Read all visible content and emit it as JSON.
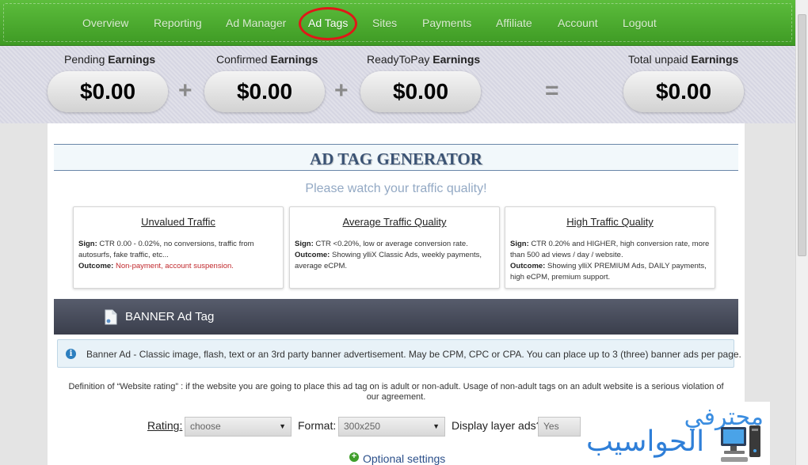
{
  "nav": {
    "items": [
      {
        "label": "Overview"
      },
      {
        "label": "Reporting"
      },
      {
        "label": "Ad Manager"
      },
      {
        "label": "Ad Tags"
      },
      {
        "label": "Sites"
      },
      {
        "label": "Payments"
      },
      {
        "label": "Affiliate"
      },
      {
        "label": "Account"
      },
      {
        "label": "Logout"
      }
    ],
    "active": "Ad Tags"
  },
  "earnings": {
    "pending": {
      "prefix": "Pending",
      "suffix": "Earnings",
      "value": "$0.00"
    },
    "confirmed": {
      "prefix": "Confirmed",
      "suffix": "Earnings",
      "value": "$0.00"
    },
    "readytopay": {
      "prefix": "ReadyToPay",
      "suffix": "Earnings",
      "value": "$0.00"
    },
    "total": {
      "prefix": "Total unpaid",
      "suffix": "Earnings",
      "value": "$0.00"
    },
    "plus": "+",
    "equals": "="
  },
  "generator": {
    "title": "AD TAG GENERATOR",
    "subtitle": "Please watch your traffic quality!"
  },
  "cards": [
    {
      "title": "Unvalued Traffic",
      "sign_label": "Sign:",
      "sign_text": "CTR 0.00 - 0.02%, no conversions, traffic from autosurfs, fake traffic, etc...",
      "outcome_label": "Outcome:",
      "outcome_text": "Non-payment, account suspension."
    },
    {
      "title": "Average Traffic Quality",
      "sign_label": "Sign:",
      "sign_text": "CTR <0.20%, low or average conversion rate.",
      "outcome_label": "Outcome:",
      "outcome_text": "Showing ylliX Classic Ads, weekly payments, average eCPM."
    },
    {
      "title": "High Traffic Quality",
      "sign_label": "Sign:",
      "sign_text": "CTR 0.20% and HIGHER, high conversion rate, more than 500 ad views / day / website.",
      "outcome_label": "Outcome:",
      "outcome_text": "Showing ylliX PREMIUM Ads, DAILY payments, high eCPM, premium support."
    }
  ],
  "banner": {
    "title": "BANNER Ad Tag",
    "info": "Banner Ad - Classic image, flash, text or an 3rd party banner advertisement. May be CPM, CPC or CPA. You can place up to 3 (three) banner ads per page.",
    "definition": "Definition of “Website rating” : if the website you are going to place this ad tag on is adult or non-adult. Usage of non-adult tags on an adult website is a serious violation of our agreement."
  },
  "form": {
    "rating_label": "Rating:",
    "rating_value": "choose",
    "format_label": "Format:",
    "format_value": "300x250",
    "layer_label": "Display layer ads?",
    "layer_value": "Yes",
    "arrow": "▼"
  },
  "optional": {
    "icon": "+",
    "label": "Optional settings"
  },
  "logo": {
    "word1": "محترفي",
    "word2": "الحواسيب"
  },
  "colors": {
    "nav_green": "#4fae33",
    "highlight_ring": "#e01818",
    "title_blue": "#3b5374",
    "outcome_red": "#c0282c",
    "banner_bar": "#4a4e5d",
    "link_blue": "#2b4f8a"
  }
}
